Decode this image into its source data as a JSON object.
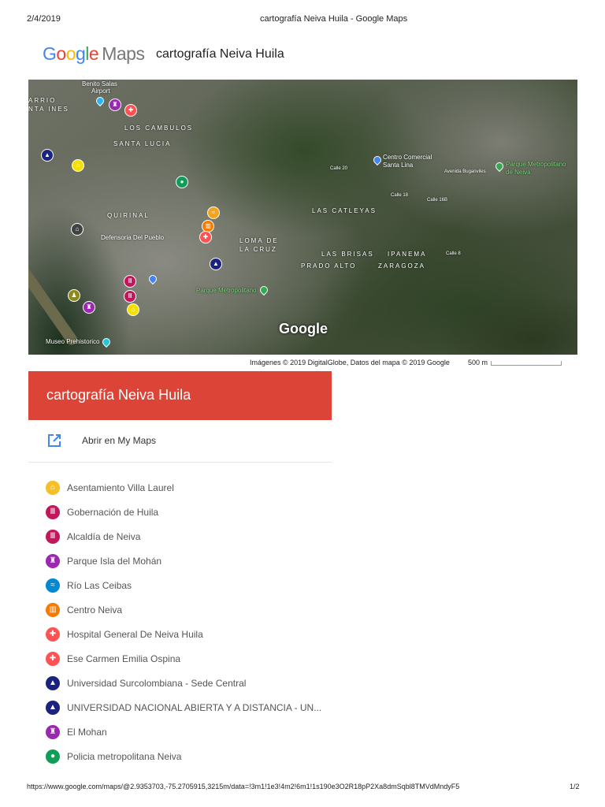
{
  "print_header": {
    "date": "2/4/2019",
    "title": "cartografía Neiva Huila - Google Maps"
  },
  "logo": {
    "google": "Google",
    "maps": "Maps"
  },
  "doc_title": "cartografía Neiva Huila",
  "map": {
    "labels": [
      "ARRIO",
      "NTA INES",
      "Benito Salas",
      "Airport",
      "LOS CAMBULOS",
      "SANTA LUCIA",
      "QUIRINAL",
      "Defensoria Del Pueblo",
      "LOMA DE",
      "LA CRUZ",
      "Parque Metropolitano",
      "Museo Prehistorico",
      "Centro Comercial",
      "Santa Lina",
      "Parque Metropolitano",
      "de Neiva",
      "Avenida Buganviles",
      "LAS CATLEYAS",
      "LAS BRISAS",
      "IPANEMA",
      "PRADO ALTO",
      "ZARAGOZA",
      "Calle 20",
      "Calle 18",
      "Calle 16B",
      "Calle 8"
    ],
    "watermark": "Google",
    "attribution": "Imágenes © 2019 DigitalGlobe, Datos del mapa © 2019 Google",
    "scale": "500 m"
  },
  "panel": {
    "title": "cartografía Neiva Huila",
    "open_label": "Abrir en My Maps",
    "items": [
      {
        "label": "Asentamiento Villa Laurel",
        "icon": "settlement-icon",
        "color": "#f6bf26"
      },
      {
        "label": "Gobernación de Huila",
        "icon": "government-building-icon",
        "color": "#c2185b"
      },
      {
        "label": "Alcaldía de Neiva",
        "icon": "government-building-icon",
        "color": "#c2185b"
      },
      {
        "label": "Parque Isla del Mohán",
        "icon": "monument-icon",
        "color": "#9c27b0"
      },
      {
        "label": "Río Las Ceibas",
        "icon": "waterfall-icon",
        "color": "#0288d1"
      },
      {
        "label": "Centro Neiva",
        "icon": "city-icon",
        "color": "#f57c00"
      },
      {
        "label": "Hospital General De Neiva Huila",
        "icon": "hospital-icon",
        "color": "#ff5252"
      },
      {
        "label": "Ese Carmen Emilia Ospina",
        "icon": "hospital-icon",
        "color": "#ff5252"
      },
      {
        "label": "Universidad Surcolombiana - Sede Central",
        "icon": "graduation-cap-icon",
        "color": "#1a237e"
      },
      {
        "label": "UNIVERSIDAD NACIONAL ABIERTA Y A DISTANCIA - UN...",
        "icon": "graduation-cap-icon",
        "color": "#1a237e"
      },
      {
        "label": "El Mohan",
        "icon": "monument-icon",
        "color": "#9c27b0"
      },
      {
        "label": "Policia metropolitana Neiva",
        "icon": "police-icon",
        "color": "#0f9d58"
      }
    ]
  },
  "print_footer": {
    "url": "https://www.google.com/maps/@2.9353703,-75.2705915,3215m/data=!3m1!1e3!4m2!6m1!1s190e3O2R18pP2Xa8dmSqbl8TMVdMndyF5",
    "page": "1/2"
  }
}
